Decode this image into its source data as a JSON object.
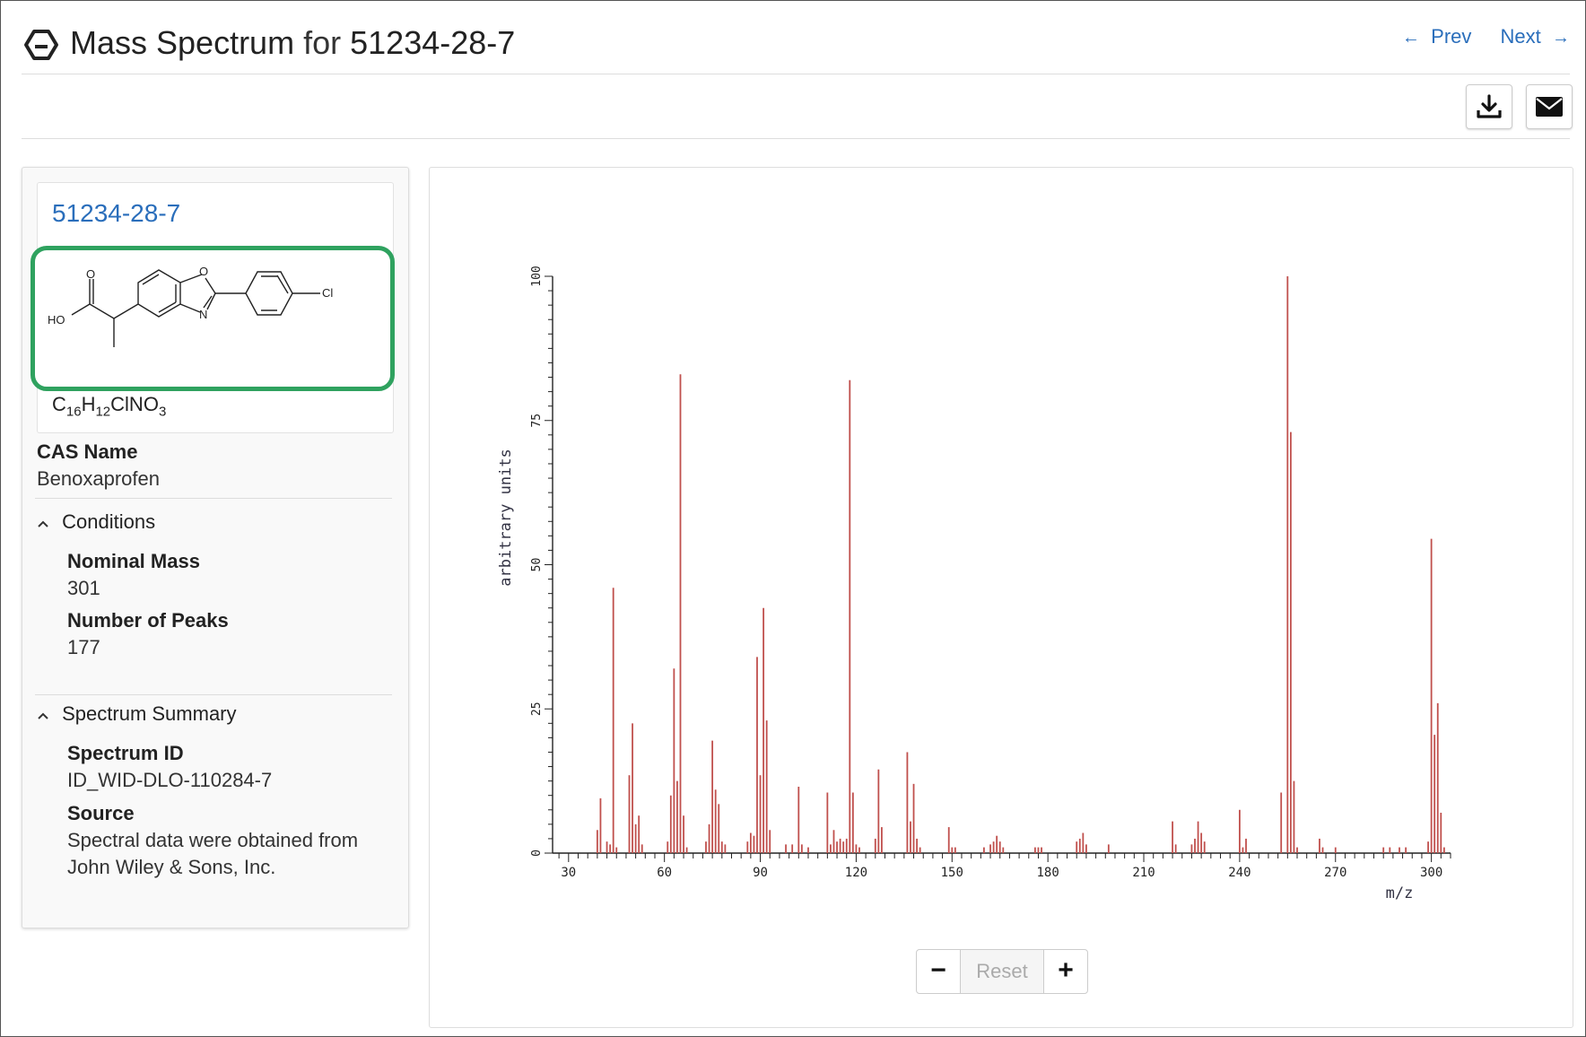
{
  "header": {
    "title_prefix": "Mass Spectrum",
    "title_for": "for",
    "title_cas": "51234-28-7",
    "prev_label": "Prev",
    "next_label": "Next",
    "prev_arrow": "←",
    "next_arrow": "→"
  },
  "toolbar": {
    "download_icon": "download-icon",
    "email_icon": "envelope-icon"
  },
  "compound": {
    "cas_link": "51234-28-7",
    "structure_atoms": [
      "O",
      "O",
      "N",
      "HO",
      "Cl"
    ],
    "formula_parts": [
      "C",
      "16",
      "H",
      "12",
      "ClNO",
      "3"
    ],
    "cas_name_label": "CAS Name",
    "cas_name": "Benoxaprofen"
  },
  "conditions": {
    "heading": "Conditions",
    "nominal_mass_label": "Nominal Mass",
    "nominal_mass": "301",
    "peaks_label": "Number of Peaks",
    "peaks": "177"
  },
  "summary": {
    "heading": "Spectrum Summary",
    "id_label": "Spectrum ID",
    "id": "ID_WID-DLO-110284-7",
    "source_label": "Source",
    "source_line1": "Spectral data were obtained from",
    "source_line2": "John Wiley & Sons, Inc."
  },
  "zoom": {
    "minus": "−",
    "reset": "Reset",
    "plus": "+"
  },
  "colors": {
    "accent": "#2a6ebb",
    "structure_border": "#2fa25f",
    "peak": "#c0504d"
  },
  "chart_data": {
    "type": "bar",
    "xlabel": "m/z",
    "ylabel": "arbitrary units",
    "xlim": [
      25,
      306
    ],
    "ylim": [
      0,
      100
    ],
    "xticks": [
      30,
      60,
      90,
      120,
      150,
      180,
      210,
      240,
      270,
      300
    ],
    "yticks": [
      0,
      25,
      50,
      75,
      100
    ],
    "peaks": [
      [
        39,
        4
      ],
      [
        40,
        9.5
      ],
      [
        42,
        2
      ],
      [
        43,
        1.5
      ],
      [
        44,
        46
      ],
      [
        45,
        1
      ],
      [
        49,
        13.5
      ],
      [
        50,
        22.5
      ],
      [
        51,
        5
      ],
      [
        52,
        6.5
      ],
      [
        53,
        1.5
      ],
      [
        61,
        2
      ],
      [
        62,
        10
      ],
      [
        63,
        32
      ],
      [
        64,
        12.5
      ],
      [
        65,
        83
      ],
      [
        66,
        6.5
      ],
      [
        67,
        1
      ],
      [
        73,
        2
      ],
      [
        74,
        5
      ],
      [
        75,
        19.5
      ],
      [
        76,
        11
      ],
      [
        77,
        8.5
      ],
      [
        78,
        2
      ],
      [
        79,
        1.5
      ],
      [
        86,
        2
      ],
      [
        87,
        3.5
      ],
      [
        88,
        3
      ],
      [
        89,
        34
      ],
      [
        90,
        13.5
      ],
      [
        91,
        42.5
      ],
      [
        92,
        23
      ],
      [
        93,
        4
      ],
      [
        98,
        1.5
      ],
      [
        100,
        1.5
      ],
      [
        102,
        11.5
      ],
      [
        103,
        1.5
      ],
      [
        105,
        1
      ],
      [
        111,
        10.5
      ],
      [
        112,
        1.5
      ],
      [
        113,
        4
      ],
      [
        114,
        2
      ],
      [
        115,
        2.5
      ],
      [
        116,
        2
      ],
      [
        117,
        2.5
      ],
      [
        118,
        82
      ],
      [
        119,
        10.5
      ],
      [
        120,
        1.5
      ],
      [
        121,
        1
      ],
      [
        126,
        2.5
      ],
      [
        127,
        14.5
      ],
      [
        128,
        4.5
      ],
      [
        136,
        17.5
      ],
      [
        137,
        5.5
      ],
      [
        138,
        12
      ],
      [
        139,
        2.5
      ],
      [
        140,
        1
      ],
      [
        149,
        4.5
      ],
      [
        150,
        1
      ],
      [
        151,
        1
      ],
      [
        160,
        1
      ],
      [
        162,
        1.5
      ],
      [
        163,
        2
      ],
      [
        164,
        3
      ],
      [
        165,
        2
      ],
      [
        166,
        1
      ],
      [
        176,
        1
      ],
      [
        177,
        1
      ],
      [
        178,
        1
      ],
      [
        189,
        2
      ],
      [
        190,
        2.5
      ],
      [
        191,
        3.5
      ],
      [
        192,
        1.5
      ],
      [
        199,
        1.5
      ],
      [
        219,
        5.5
      ],
      [
        220,
        1.5
      ],
      [
        225,
        1.5
      ],
      [
        226,
        2.5
      ],
      [
        227,
        5.5
      ],
      [
        228,
        3.5
      ],
      [
        229,
        2
      ],
      [
        240,
        7.5
      ],
      [
        241,
        1
      ],
      [
        242,
        2.5
      ],
      [
        253,
        10.5
      ],
      [
        255,
        100
      ],
      [
        256,
        73
      ],
      [
        257,
        12.5
      ],
      [
        258,
        1
      ],
      [
        265,
        2.5
      ],
      [
        266,
        1
      ],
      [
        270,
        1
      ],
      [
        285,
        1
      ],
      [
        287,
        1
      ],
      [
        290,
        1
      ],
      [
        292,
        1
      ],
      [
        299,
        2
      ],
      [
        300,
        54.5
      ],
      [
        301,
        20.5
      ],
      [
        302,
        26
      ],
      [
        303,
        7
      ],
      [
        304,
        1
      ]
    ]
  }
}
